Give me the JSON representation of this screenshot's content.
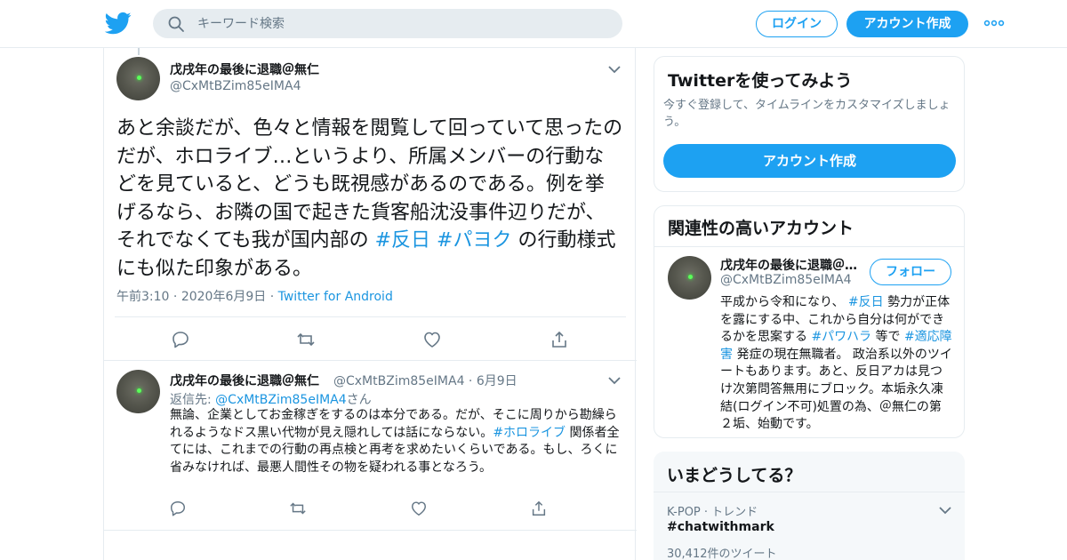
{
  "colors": {
    "brand": "#1da1f2",
    "link": "#1b95e0",
    "secondary_text": "#657786",
    "border": "#e6ecf0"
  },
  "header": {
    "search_placeholder": "キーワード検索",
    "login_label": "ログイン",
    "signup_label": "アカウント作成"
  },
  "main_tweet": {
    "name": "戊戌年の最後に退職＠無仁",
    "handle": "@CxMtBZim85eIMA4",
    "text_before": "あと余談だが、色々と情報を閲覧して回っていて思ったのだが、ホロライブ…というより、所属メンバーの行動などを見ていると、どうも既視感があるのである。例を挙げるなら、お隣の国で起きた貨客船沈没事件辺りだが、それでなくても我が国内部の ",
    "hashtag_1": "#反日",
    "hashtag_2": "#パヨク",
    "text_after": " の行動様式にも似た印象がある。",
    "time": "午前3:10",
    "date": "2020年6月9日",
    "source": "Twitter for Android"
  },
  "reply_tweet": {
    "name": "戊戌年の最後に退職＠無仁",
    "handle": "@CxMtBZim85eIMA4",
    "date": "6月9日",
    "reply_prefix": "返信先: ",
    "reply_to": "@CxMtBZim85eIMA4",
    "reply_suffix": "さん",
    "text_before": "無論、企業としてお金稼ぎをするのは本分である。だが、そこに周りから勘繰られるようなドス黒い代物が見え隠れしては話にならない。",
    "hashtag": "#ホロライブ",
    "text_after": " 関係者全てには、これまでの行動の再点検と再考を求めたいくらいである。もし、ろくに省みなければ、最悪人間性その物を疑われる事となろう。"
  },
  "signup_card": {
    "title": "Twitterを使ってみよう",
    "desc": "今すぐ登録して、タイムラインをカスタマイズしましょう。",
    "cta": "アカウント作成"
  },
  "related_card": {
    "title": "関連性の高いアカウント",
    "name": "戊戌年の最後に退職＠無仁",
    "handle": "@CxMtBZim85eIMA4",
    "follow": "フォロー",
    "bio_1": "平成から令和になり、 ",
    "bio_tag_1": "#反日",
    "bio_2": " 勢力が正体を露にする中、これから自分は何ができるかを思案する ",
    "bio_tag_2": "#パワハラ",
    "bio_3": " 等で ",
    "bio_tag_3": "#適応障害",
    "bio_4": " 発症の現在無職者。 政治系以外のツイートもあります。あと、反日アカは見つけ次第問答無用にブロック。本垢永久凍結(ログイン不可)処置の為、＠無仁の第２垢、始動です。"
  },
  "trends_card": {
    "title": "いまどうしてる？",
    "context": "K-POP · トレンド",
    "trend": "#chatwithmark",
    "count": "30,412件のツイート"
  }
}
